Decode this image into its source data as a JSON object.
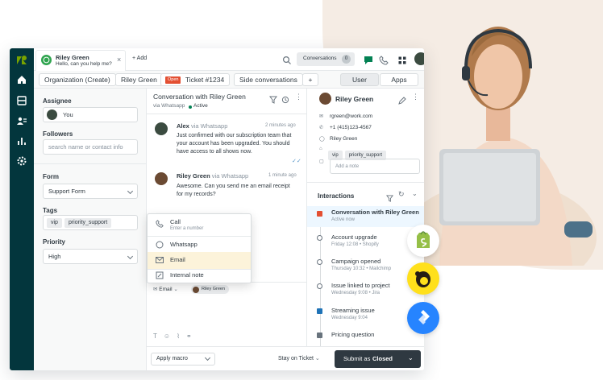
{
  "topbar": {
    "tab_name": "Riley Green",
    "tab_message": "Hello, can you help me?",
    "add_label": "+ Add",
    "conversations_label": "Conversations",
    "conversations_count": "0"
  },
  "tabbar": {
    "org_label": "Organization (Create)",
    "user_label": "Riley Green",
    "status_badge": "Open",
    "ticket_label": "Ticket #1234",
    "side_conv_label": "Side conversations",
    "plus_label": "+",
    "user_tab": "User",
    "apps_tab": "Apps"
  },
  "left": {
    "assignee_label": "Assignee",
    "assignee_value": "You",
    "followers_label": "Followers",
    "followers_placeholder": "search name or contact info",
    "form_label": "Form",
    "form_value": "Support Form",
    "tags_label": "Tags",
    "tags": [
      "vip",
      "priority_support"
    ],
    "priority_label": "Priority",
    "priority_value": "High"
  },
  "conversation": {
    "title": "Conversation with Riley Green",
    "via": "via Whatsapp",
    "status": "Active",
    "messages": [
      {
        "author": "Alex",
        "via": "via Whatsapp",
        "time": "2 minutes ago",
        "text": [
          "Just confirmed with our subscription team that",
          "your account has been upgraded. You should",
          "have access to all shows now."
        ]
      },
      {
        "author": "Riley Green",
        "via": "via Whatsapp",
        "time": "1 minute ago",
        "text": [
          "Awesome. Can you send me an email receipt",
          "for my records?"
        ]
      }
    ],
    "channel_menu": [
      {
        "label": "Call",
        "sub": "Enter a number",
        "icon": "phone-icon"
      },
      {
        "label": "Whatsapp",
        "icon": "whatsapp-icon"
      },
      {
        "label": "Email",
        "icon": "mail-icon"
      },
      {
        "label": "Internal note",
        "icon": "note-icon"
      }
    ],
    "compose_channel": "Email",
    "compose_recipient": "Riley Green"
  },
  "bottom": {
    "macro_label": "Apply macro",
    "stay_label": "Stay on Ticket",
    "submit_prefix": "Submit as",
    "submit_status": "Closed"
  },
  "profile": {
    "name": "Riley Green",
    "email": "rgreen@work.com",
    "phone": "+1 (415)123-4567",
    "whatsapp": "Riley Green",
    "tags": [
      "vip",
      "priority_support"
    ],
    "note_placeholder": "Add a note"
  },
  "interactions": {
    "title": "Interactions",
    "items": [
      {
        "title": "Conversation with Riley Green",
        "sub": "Active now"
      },
      {
        "title": "Account upgrade",
        "sub": "Friday 12:08 • Shopify"
      },
      {
        "title": "Campaign opened",
        "sub": "Thursday 10:32 • Mailchimp"
      },
      {
        "title": "Issue linked to project",
        "sub": "Wednesday 9:08 • Jira"
      },
      {
        "title": "Streaming issue",
        "sub": "Wednesday 9:04"
      },
      {
        "title": "Pricing question",
        "sub": ""
      }
    ]
  },
  "colors": {
    "rail": "#03363d",
    "accent_green": "#038153",
    "open_badge": "#e34f32",
    "submit_bg": "#2f3941",
    "shopify": "#95bf47",
    "mailchimp": "#ffe01b",
    "jira": "#2684ff"
  }
}
